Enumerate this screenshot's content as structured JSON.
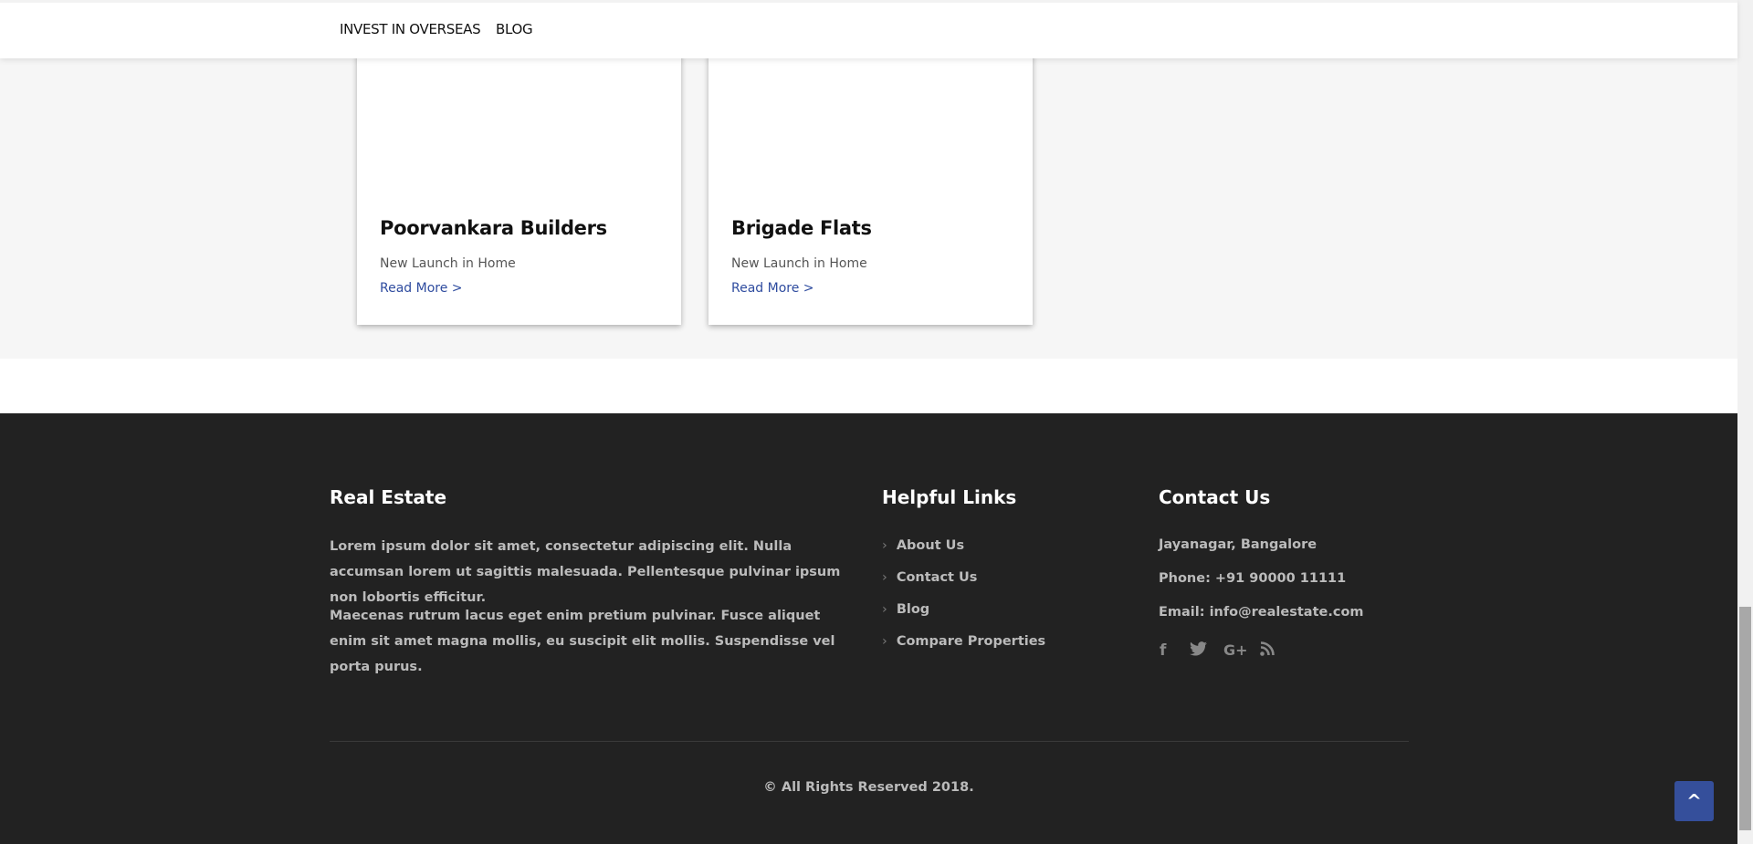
{
  "nav": {
    "items": [
      "INVEST IN OVERSEAS",
      "BLOG"
    ]
  },
  "cards": [
    {
      "title": "Poorvankara Builders",
      "subtitle": "New Launch in Home",
      "link": "Read More >"
    },
    {
      "title": "Brigade Flats",
      "subtitle": "New Launch in Home",
      "link": "Read More >"
    }
  ],
  "footer": {
    "about": {
      "heading": "Real Estate",
      "p1": "Lorem ipsum dolor sit amet, consectetur adipiscing elit. Nulla accumsan lorem ut sagittis malesuada. Pellentesque pulvinar ipsum non lobortis efficitur.",
      "p2": "Maecenas rutrum lacus eget enim pretium pulvinar. Fusce aliquet enim sit amet magna mollis, eu suscipit elit mollis. Suspendisse vel porta purus."
    },
    "links": {
      "heading": "Helpful Links",
      "items": [
        "About Us",
        "Contact Us",
        "Blog",
        "Compare Properties"
      ]
    },
    "contact": {
      "heading": "Contact Us",
      "address": "Jayanagar, Bangalore",
      "phone": "Phone: +91 90000 11111",
      "email": "Email: info@realestate.com"
    },
    "social": [
      "facebook-icon",
      "twitter-icon",
      "google-plus-icon",
      "rss-icon"
    ],
    "copyright": "©  All Rights Reserved 2018."
  },
  "back_to_top": "^"
}
